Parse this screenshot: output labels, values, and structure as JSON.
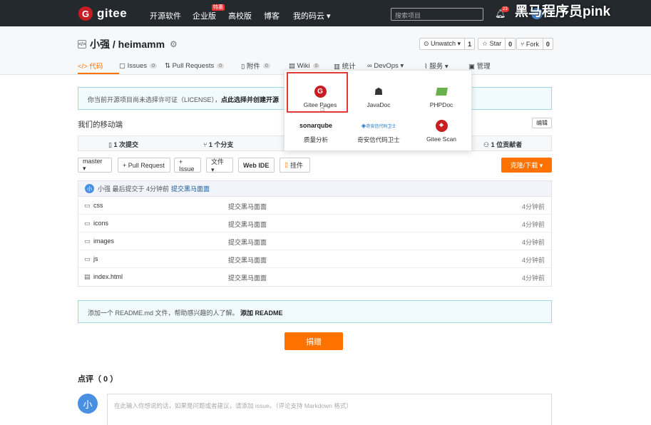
{
  "topnav": {
    "logo_text": "gitee",
    "links": [
      "开源软件",
      "企业版",
      "高校版",
      "博客",
      "我的码云 ▾"
    ],
    "enterprise_badge": "特惠",
    "search_placeholder": "搜索项目",
    "notification_count": "23",
    "plus_label": "+",
    "avatar_letter": "小",
    "watermark": "黑马程序员pink"
  },
  "repo": {
    "icon": "</>",
    "title": "小强 / heimamm",
    "actions": [
      {
        "label": "⊙ Unwatch ▾",
        "count": "1"
      },
      {
        "label": "☆ Star",
        "count": "0"
      },
      {
        "label": "⑂ Fork",
        "count": "0"
      }
    ]
  },
  "tabs": [
    {
      "label": "</> 代码",
      "count": ""
    },
    {
      "label": "▢ Issues",
      "count": "0"
    },
    {
      "label": "⇅ Pull Requests",
      "count": "0"
    },
    {
      "label": "▯ 附件",
      "count": "0"
    },
    {
      "label": "▤ Wiki",
      "count": "0"
    },
    {
      "label": "▥ 统计",
      "count": ""
    },
    {
      "label": "∞ DevOps ▾",
      "count": ""
    },
    {
      "label": "⌇ 服务 ▾",
      "count": ""
    },
    {
      "label": "▣ 管理",
      "count": ""
    }
  ],
  "license_notice": {
    "text": "你当前开源项目尚未选择许可证（LICENSE），",
    "link": "点此选择并创建开源"
  },
  "description": {
    "text": "我们的移动端",
    "edit_label": "编辑"
  },
  "stats": {
    "commits": "1 次提交",
    "branches": "1 个分支",
    "contributors": "1 位贡献者"
  },
  "toolbar": {
    "branch": "master ▾",
    "pull_request": "+ Pull Request",
    "issue": "+ Issue",
    "files": "文件 ▾",
    "web_ide": "Web IDE",
    "hook": "挂件",
    "download": "克隆/下载 ▾"
  },
  "commit": {
    "avatar": "小",
    "author_line": "小强 最后提交于 4分钟前",
    "message": "提交黑马面面"
  },
  "files": [
    {
      "icon": "folder",
      "name": "css",
      "message": "提交黑马面面",
      "time": "4分钟前"
    },
    {
      "icon": "folder",
      "name": "icons",
      "message": "提交黑马面面",
      "time": "4分钟前"
    },
    {
      "icon": "folder",
      "name": "images",
      "message": "提交黑马面面",
      "time": "4分钟前"
    },
    {
      "icon": "folder",
      "name": "js",
      "message": "提交黑马面面",
      "time": "4分钟前"
    },
    {
      "icon": "file",
      "name": "index.html",
      "message": "提交黑马面面",
      "time": "4分钟前"
    }
  ],
  "readme_notice": {
    "text": "添加一个 README.md 文件，帮助感兴趣的人了解。",
    "link": "添加 README"
  },
  "donate_label": "捐赠",
  "reviews_title": "点评（ 0 ）",
  "comment": {
    "avatar": "小",
    "placeholder": "在此输入你想说的话，如果是问题或者建议，请添加 issue。（评论支持 Markdown 格式）"
  },
  "services_menu": {
    "items": [
      {
        "label": "Gitee Pages"
      },
      {
        "label": "JavaDoc"
      },
      {
        "label": "PHPDoc"
      },
      {
        "label": "质量分析",
        "logo": "sonarqube"
      },
      {
        "label": "奇安信代码卫士",
        "logo": "奇安信代码卫士"
      },
      {
        "label": "Gitee Scan"
      }
    ]
  },
  "colors": {
    "nav_bg": "#24292e",
    "accent": "#fe7300",
    "brand": "#c71d23",
    "highlight": "#e53935"
  }
}
